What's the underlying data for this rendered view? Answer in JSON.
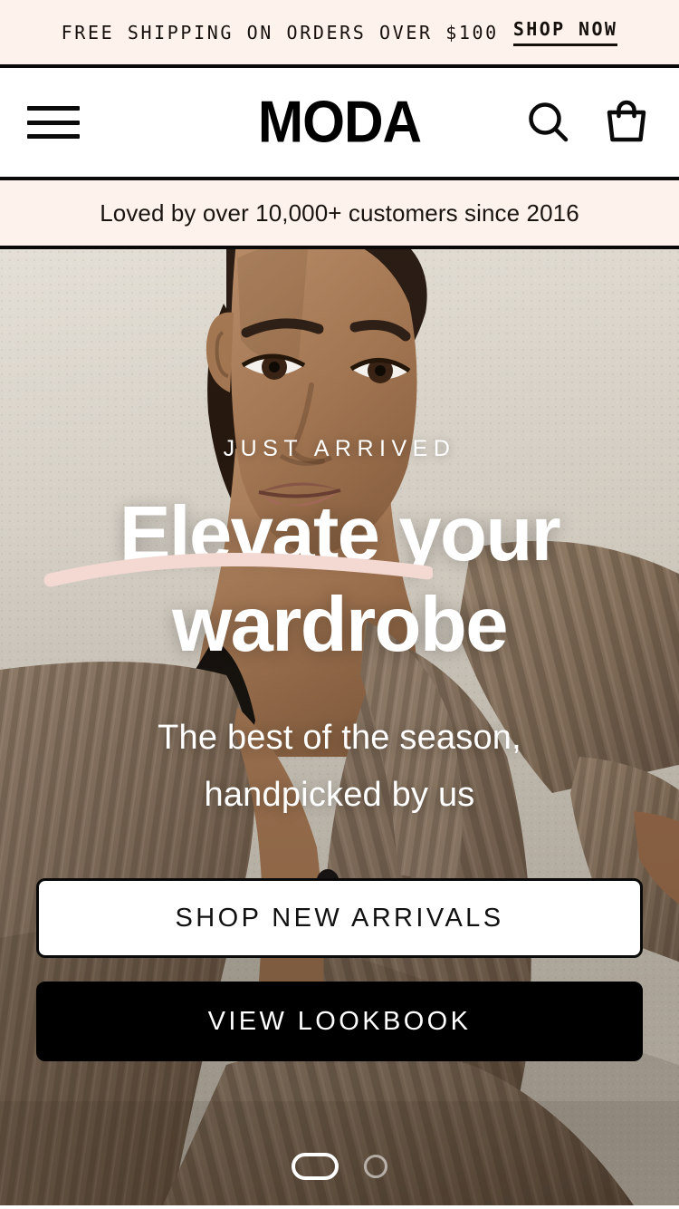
{
  "announcement": {
    "message": "FREE SHIPPING ON ORDERS OVER $100",
    "cta_label": "SHOP NOW"
  },
  "header": {
    "menu_icon": "hamburger-menu-icon",
    "logo": "MODA",
    "search_icon": "search-icon",
    "cart_icon": "shopping-bag-icon"
  },
  "trustbar": {
    "text": "Loved by over 10,000+ customers since 2016"
  },
  "hero": {
    "eyebrow": "JUST ARRIVED",
    "headline_line1": "Elevate your",
    "headline_line2": "wardrobe",
    "subhead_line1": "The best of the season,",
    "subhead_line2": "handpicked by us",
    "primary_cta": "SHOP NEW ARRIVALS",
    "secondary_cta": "VIEW LOOKBOOK"
  },
  "carousel": {
    "active_indicator": "slide-1",
    "inactive_indicator": "slide-2"
  },
  "colors": {
    "cream": "#fdf2ec",
    "ink": "#0a0a0a",
    "underline_blush": "#f3d9d2",
    "white": "#ffffff"
  }
}
